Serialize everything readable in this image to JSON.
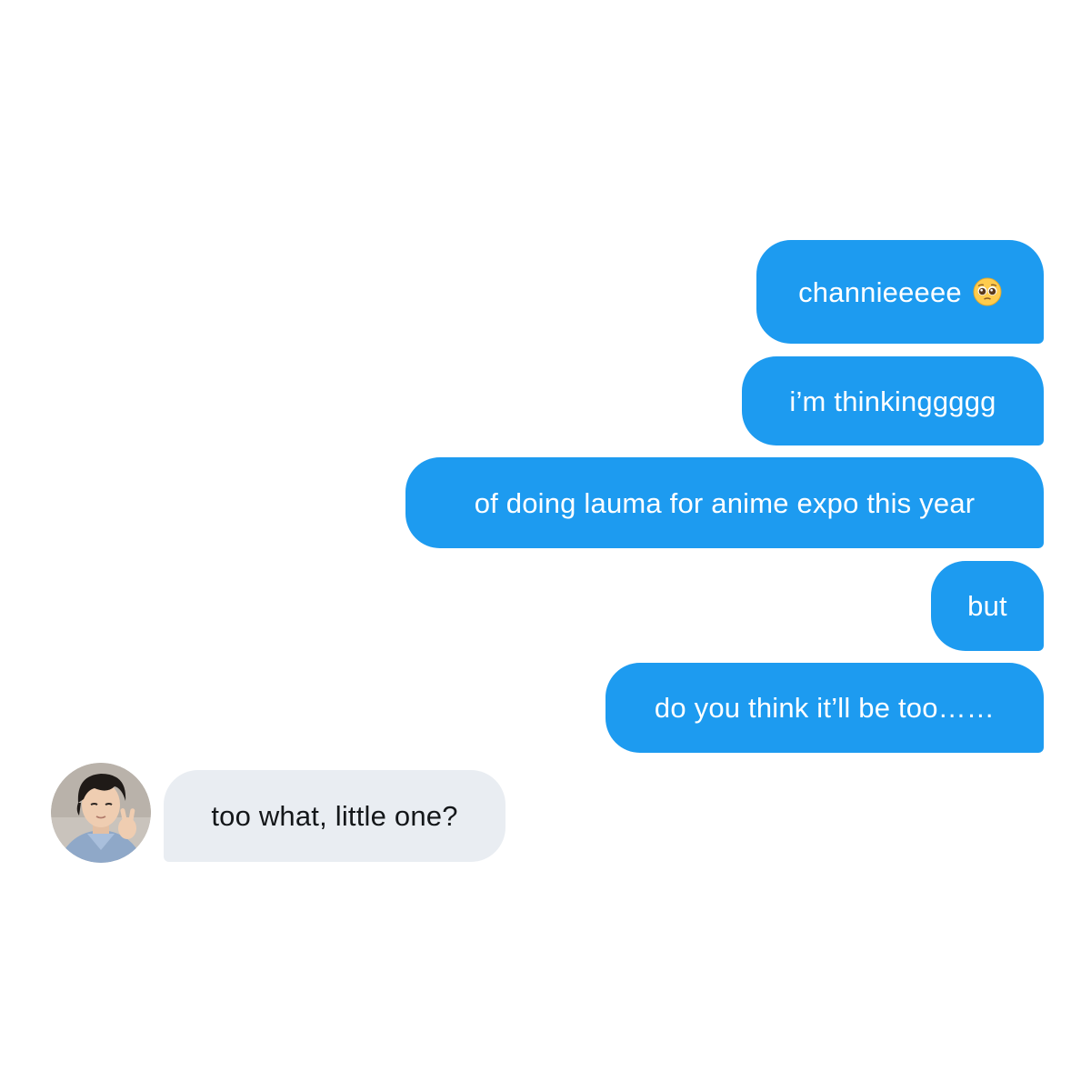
{
  "conversation": {
    "sent_messages": [
      {
        "text": "channieeeee",
        "emoji": "pleading-face-icon"
      },
      {
        "text": "i’m thinkinggggg"
      },
      {
        "text": "of doing lauma for anime expo this year"
      },
      {
        "text": "but"
      },
      {
        "text": "do you think it’ll be too……"
      }
    ],
    "received_messages": [
      {
        "text": "too what, little one?"
      }
    ],
    "colors": {
      "sent_bubble": "#1d9bf0",
      "sent_text": "#ffffff",
      "received_bubble": "#e9edf2",
      "received_text": "#14171a"
    },
    "avatar": {
      "icon": "contact-avatar"
    }
  }
}
